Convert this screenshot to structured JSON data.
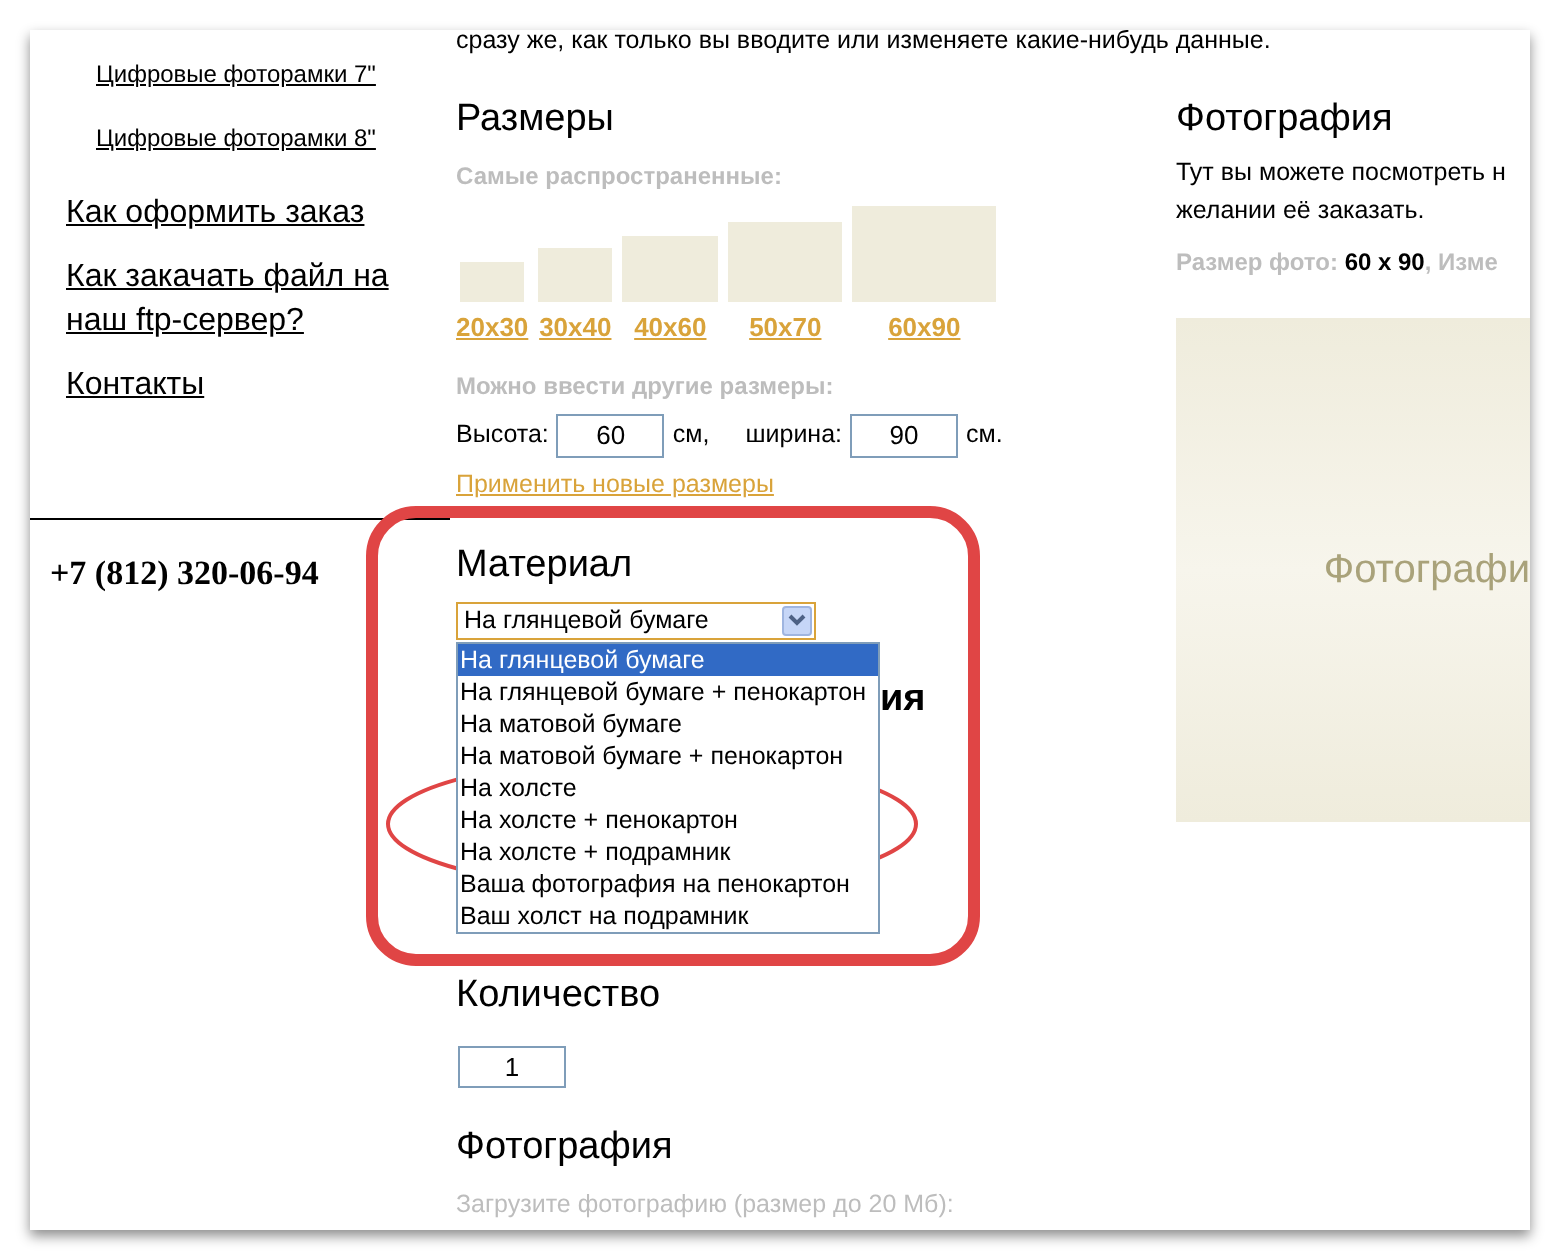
{
  "intro_text": "сразу же, как только вы вводите или изменяете какие-нибудь данные.",
  "sidebar": {
    "subitems": [
      "Цифровые фоторамки 7\"",
      "Цифровые фоторамки 8\""
    ],
    "links": [
      "Как оформить заказ",
      "Как закачать файл на наш ftp-сервер?",
      "Контакты"
    ],
    "phone": "+7 (812) 320-06-94"
  },
  "sizes": {
    "title": "Размеры",
    "common_label": "Самые распространенные:",
    "presets": [
      "20x30",
      "30x40",
      "40x60",
      "50x70",
      "60x90"
    ],
    "custom_label": "Можно ввести другие размеры:",
    "height_label": "Высота:",
    "height_value": "60",
    "height_unit": "см,",
    "width_label": "ширина:",
    "width_value": "90",
    "width_unit": "см.",
    "apply_link": "Применить новые размеры"
  },
  "material": {
    "title": "Материал",
    "value": "На глянцевой бумаге",
    "options": [
      {
        "label": "На глянцевой бумаге",
        "selected": true
      },
      {
        "label": "На глянцевой бумаге + пенокартон",
        "selected": false
      },
      {
        "label": "На матовой бумаге",
        "selected": false
      },
      {
        "label": "На матовой бумаге + пенокартон",
        "selected": false
      },
      {
        "label": "На холсте",
        "selected": false
      },
      {
        "label": "На холсте + пенокартон",
        "selected": false
      },
      {
        "label": "На холсте + подрамник",
        "selected": false
      },
      {
        "label": "Ваша фотография на пенокартон",
        "selected": false
      },
      {
        "label": "Ваш холст на подрамник",
        "selected": false
      }
    ]
  },
  "covered_heading_tail": "ия",
  "quantity": {
    "title": "Количество",
    "value": "1"
  },
  "upload": {
    "title": "Фотография",
    "hint": "Загрузите фотографию (размер до 20 Мб):"
  },
  "preview": {
    "title": "Фотография",
    "lines": [
      "Тут вы можете посмотреть н",
      "желании её заказать."
    ],
    "size_line": "Размер фото: **60 x 90**, Изме",
    "placeholder": "Фотографи"
  }
}
